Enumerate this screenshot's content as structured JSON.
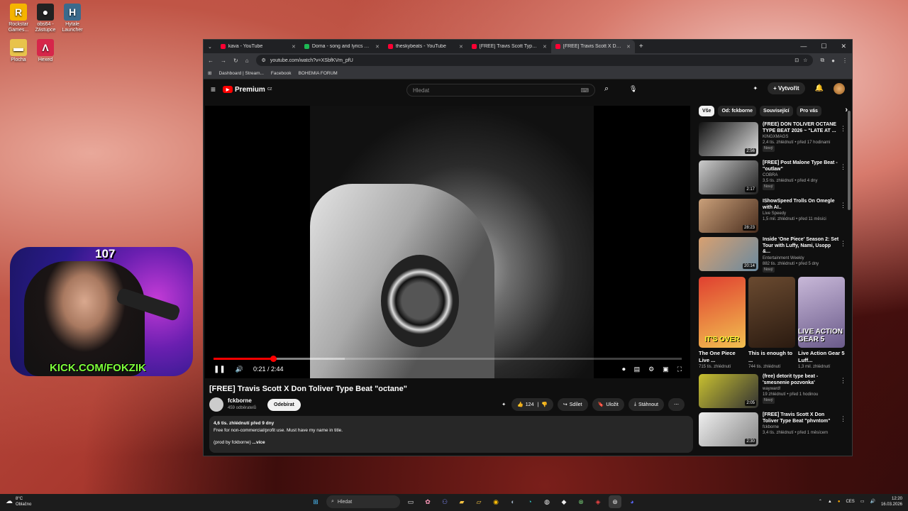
{
  "desktop": {
    "icons": [
      {
        "label": "Rockstar Games...",
        "color": "#f5b400",
        "glyph": "R"
      },
      {
        "label": "obs64 - Zástupce",
        "color": "#222",
        "glyph": "●"
      },
      {
        "label": "Hytale Launcher",
        "color": "#3b6a8c",
        "glyph": "H"
      },
      {
        "label": "Plocha",
        "color": "#e8c34b",
        "glyph": "▬"
      },
      {
        "label": "Hexed",
        "color": "#d6264a",
        "glyph": "Λ"
      }
    ]
  },
  "overlay": {
    "viewer_count": "107",
    "kick_text": "KICK.COM/FOKZIK"
  },
  "browser": {
    "tabs": [
      {
        "title": "kava - YouTube",
        "color": "#ff0033"
      },
      {
        "title": "Doma - song and lyrics by tob...",
        "color": "#1db954"
      },
      {
        "title": "theskybeats - YouTube",
        "color": "#ff0033"
      },
      {
        "title": "[FREE] Travis Scott Type Beat -...",
        "color": "#ff0033"
      },
      {
        "title": "[FREE] Travis Scott X Don To...",
        "color": "#ff0033"
      }
    ],
    "url": "youtube.com/watch?v=XSbfKVm_pfU",
    "bookmarks": [
      "Dashboard | Stream...",
      "Facebook",
      "BOHEMIA FORUM"
    ]
  },
  "youtube": {
    "brand": "Premium",
    "brand_region": "CZ",
    "search_placeholder": "Hledat",
    "create_label": "Vytvořit",
    "player": {
      "time": "0:21 / 2:44",
      "progress": 0.128
    },
    "video_title": "[FREE] Travis Scott X Don Toliver Type Beat \"octane\"",
    "channel": {
      "name": "fckborne",
      "subs": "459 odběratelů",
      "subscribe": "Odebírat"
    },
    "actions": {
      "likes": "124",
      "share": "Sdílet",
      "save": "Uložit",
      "download": "Stáhnout"
    },
    "description": {
      "stats": "4,6 tis. zhlédnutí  před 9 dny",
      "line1": "Free for non-commercial/profit use. Must have my name in title.",
      "line2": "(prod by fckborne)",
      "more": "...více"
    },
    "chips": [
      "Vše",
      "Od: fckborne",
      "Související",
      "Pro vás"
    ],
    "recommendations": [
      {
        "title": "(FREE) DON TOLIVER OCTANE TYPE BEAT 2026 ~ \"LATE AT ...",
        "channel": "KINGXMAGS",
        "meta": "2,4 tis. zhlédnutí • před 17 hodinami",
        "badge": "Nový",
        "duration": "2:56",
        "c1": "#111",
        "c2": "#ddd"
      },
      {
        "title": "[FREE] Post Malone Type Beat - \"outlaw\"",
        "channel": "COBRA",
        "meta": "3,5 tis. zhlédnutí • před 4 dny",
        "badge": "Nový",
        "duration": "2:17",
        "c1": "#ccc",
        "c2": "#222"
      },
      {
        "title": "IShowSpeed Trolls On Omegle with AI..",
        "channel": "Live Speedy",
        "meta": "1,5 mil. zhlédnutí • před 11 měsíci",
        "badge": "",
        "duration": "28:23",
        "c1": "#caa07a",
        "c2": "#4a2e1e"
      },
      {
        "title": "Inside 'One Piece' Season 2: Set Tour with Luffy, Nami, Usopp &...",
        "channel": "Entertainment Weekly",
        "meta": "882 tis. zhlédnutí • před 5 dny",
        "badge": "Nový",
        "duration": "20:14",
        "c1": "#d8a070",
        "c2": "#6a8aa0"
      }
    ],
    "shorts": [
      {
        "title": "The One Piece Live ...",
        "views": "715 tis. zhlédnutí",
        "overlay": "IT'S OVER",
        "c1": "#e04030",
        "c2": "#f2c050"
      },
      {
        "title": "This is enough to ...",
        "views": "744 tis. zhlédnutí",
        "overlay": "",
        "c1": "#6a4a30",
        "c2": "#2a1a10"
      },
      {
        "title": "Live Action Gear 5 Luff...",
        "views": "1,3 mil. zhlédnutí",
        "overlay": "LIVE ACTION GEAR 5",
        "c1": "#c8b8d8",
        "c2": "#6a5a8a"
      }
    ],
    "more_recs": [
      {
        "title": "(free) detorit type beat - 'smesnenie pozvonka'",
        "channel": "wayward!",
        "meta": "19 zhlédnutí • před 1 hodinou",
        "badge": "Nový",
        "duration": "2:05",
        "c1": "#c8c030",
        "c2": "#333"
      },
      {
        "title": "[FREE] Travis Scott X Don Toliver Type Beat \"phvntom\"",
        "channel": "fckborne",
        "meta": "3,4 tis. zhlédnutí • před 1 měsícem",
        "badge": "",
        "duration": "2:30",
        "c1": "#eee",
        "c2": "#888"
      }
    ]
  },
  "taskbar": {
    "weather_temp": "8°C",
    "weather_text": "Oblačno",
    "search_label": "Hledat",
    "lang": "CES",
    "time": "12:20",
    "date": "16.03.2026"
  }
}
